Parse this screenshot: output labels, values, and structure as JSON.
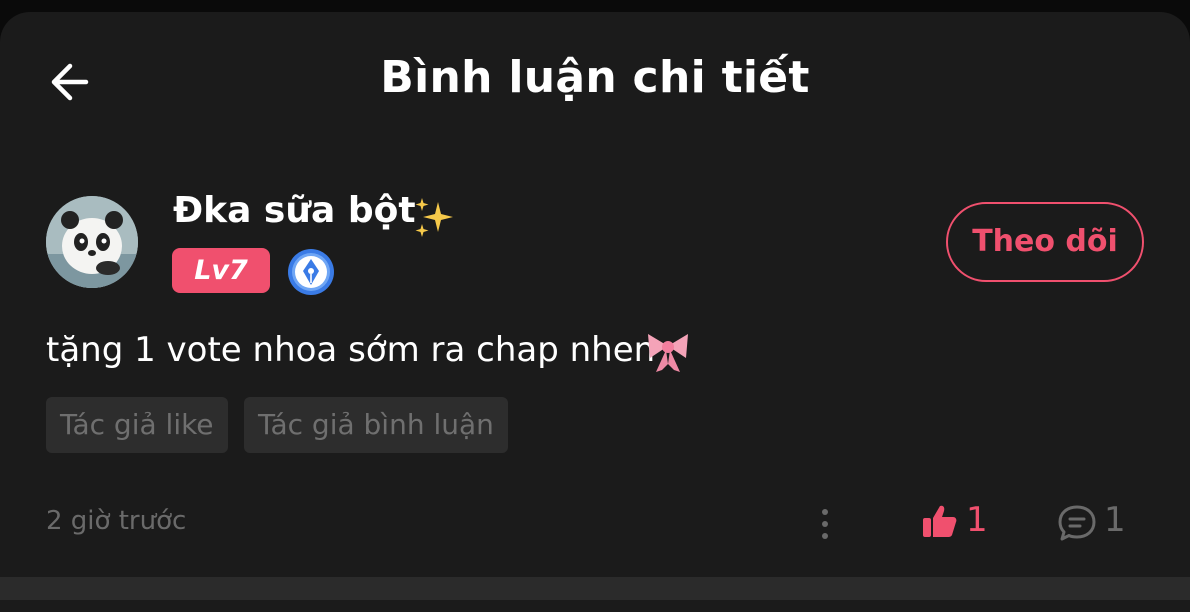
{
  "header": {
    "title": "Bình luận chi tiết",
    "back_icon": "arrow-left-icon"
  },
  "comment": {
    "author": {
      "name": "Đka sữa bột",
      "name_emoji": "sparkles-icon",
      "level": "Lv7",
      "badge_icon": "pen-nib-badge-icon",
      "avatar": "panda-avatar"
    },
    "follow_label": "Theo dõi",
    "text": "tặng 1 vote nhoa sớm ra chap nhen",
    "text_emoji": "ribbon-icon",
    "tags": [
      "Tác giả like",
      "Tác giả bình luận"
    ],
    "timestamp": "2 giờ trước",
    "likes": "1",
    "replies": "1"
  },
  "colors": {
    "accent": "#f0506e",
    "background": "#1b1b1b",
    "text": "#ffffff",
    "muted": "#6a6a6a",
    "tag_bg": "#2d2d2d"
  }
}
